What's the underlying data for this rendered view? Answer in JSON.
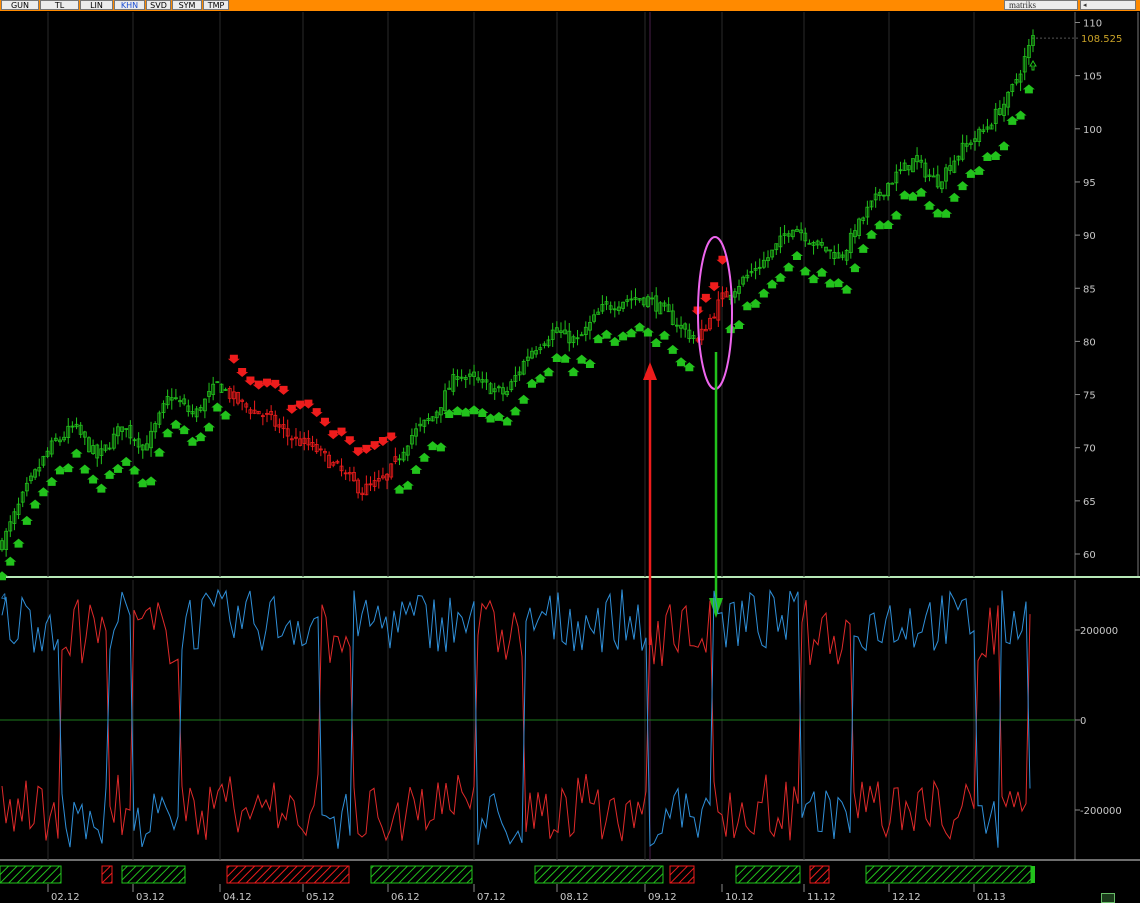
{
  "toolbar": {
    "tabs": [
      {
        "label": "GUN",
        "active": false
      },
      {
        "label": "TL",
        "active": false
      },
      {
        "label": "LIN",
        "active": false
      },
      {
        "label": "KHN",
        "active": true
      },
      {
        "label": "SVD",
        "active": false
      },
      {
        "label": "SYM",
        "active": false
      },
      {
        "label": "TMP",
        "active": false
      }
    ],
    "brand": "matriks"
  },
  "colors": {
    "bull": "#22c21c",
    "bear": "#ee1c1c",
    "blue_line": "#2f8fd8",
    "red_line": "#e02a2a",
    "zero_line": "#1d7a1d",
    "annotation_ellipse": "#ee66ee",
    "current_price": "#c9a227"
  },
  "chart_data": [
    {
      "type": "candlestick",
      "y_ticks": [
        "110",
        "105",
        "100",
        "95",
        "90",
        "85",
        "80",
        "75",
        "70",
        "65",
        "60"
      ],
      "ylim": [
        57.5,
        111
      ],
      "last_price_label": "108.525",
      "trend_segments": [
        {
          "color": "green",
          "from": "start",
          "to": "04.12"
        },
        {
          "color": "red",
          "from": "04.12",
          "to": "06.12"
        },
        {
          "color": "green",
          "from": "06.12",
          "to": "10.12"
        },
        {
          "color": "red",
          "from": "10.12",
          "to": "10.12"
        },
        {
          "color": "green",
          "from": "10.12",
          "to": "end"
        }
      ],
      "approx_close_path": [
        61,
        66,
        70,
        72,
        69,
        72,
        70,
        75,
        73,
        76,
        74,
        73,
        71,
        70,
        68,
        66,
        67,
        71,
        73,
        77,
        76,
        75,
        79,
        81,
        80,
        83,
        84,
        84,
        82,
        80,
        84,
        86,
        88,
        91,
        89,
        88,
        92,
        95,
        97,
        95,
        98,
        100,
        103,
        108.5
      ],
      "annotations": [
        {
          "shape": "ellipse",
          "color": "magenta"
        },
        {
          "shape": "arrow-up",
          "color": "red"
        },
        {
          "shape": "arrow-down",
          "color": "green"
        }
      ]
    },
    {
      "type": "line",
      "y_ticks": [
        "200000",
        "0",
        "-200000"
      ],
      "ylim": [
        -300000,
        300000
      ],
      "legend_fragment": "4",
      "series_colors": [
        "blue",
        "red"
      ]
    },
    {
      "type": "bar",
      "x_ticks": [
        "02.12",
        "03.12",
        "04.12",
        "05.12",
        "06.12",
        "07.12",
        "08.12",
        "09.12",
        "10.12",
        "11.12",
        "12.12",
        "01.13"
      ],
      "regime_blocks": [
        {
          "color": "green"
        },
        {
          "color": "red"
        },
        {
          "color": "green"
        },
        {
          "color": "red"
        },
        {
          "color": "green"
        },
        {
          "color": "green"
        },
        {
          "color": "red"
        },
        {
          "color": "green"
        },
        {
          "color": "red"
        },
        {
          "color": "green"
        }
      ]
    }
  ]
}
